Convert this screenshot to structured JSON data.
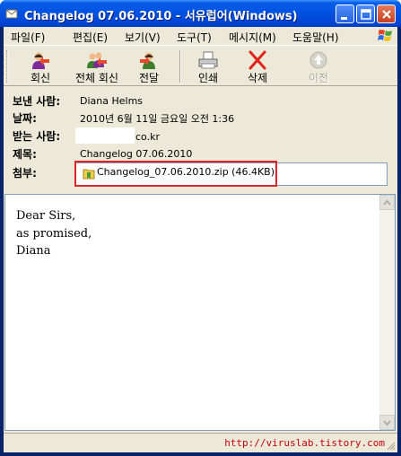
{
  "window": {
    "title": "Changelog 07.06.2010 - 서유럽어(Windows)"
  },
  "menu": [
    "파일(F)",
    "편집(E)",
    "보기(V)",
    "도구(T)",
    "메시지(M)",
    "도움말(H)"
  ],
  "toolbar": {
    "reply": "회신",
    "reply_all": "전체 회신",
    "forward": "전달",
    "print": "인쇄",
    "delete": "삭제",
    "previous": "이전"
  },
  "header": {
    "from_label": "보낸 사람:",
    "from_value": "Diana Helms",
    "date_label": "날짜:",
    "date_value": "2010년 6월 11일 금요일 오전 1:36",
    "to_label": "받는 사람:",
    "to_value": "co.kr",
    "subject_label": "제목:",
    "subject_value": "Changelog 07.06.2010",
    "attach_label": "첨부:",
    "attachment": "Changelog_07.06.2010.zip (46.4KB)"
  },
  "body": {
    "lines": [
      "Dear Sirs,",
      "as promised,",
      "Diana"
    ]
  },
  "status": {
    "watermark": "http://viruslab.tistory.com"
  },
  "colors": {
    "accent_red": "#d9252b",
    "titlebar": "#0054e3",
    "watermark": "#c8000a"
  }
}
